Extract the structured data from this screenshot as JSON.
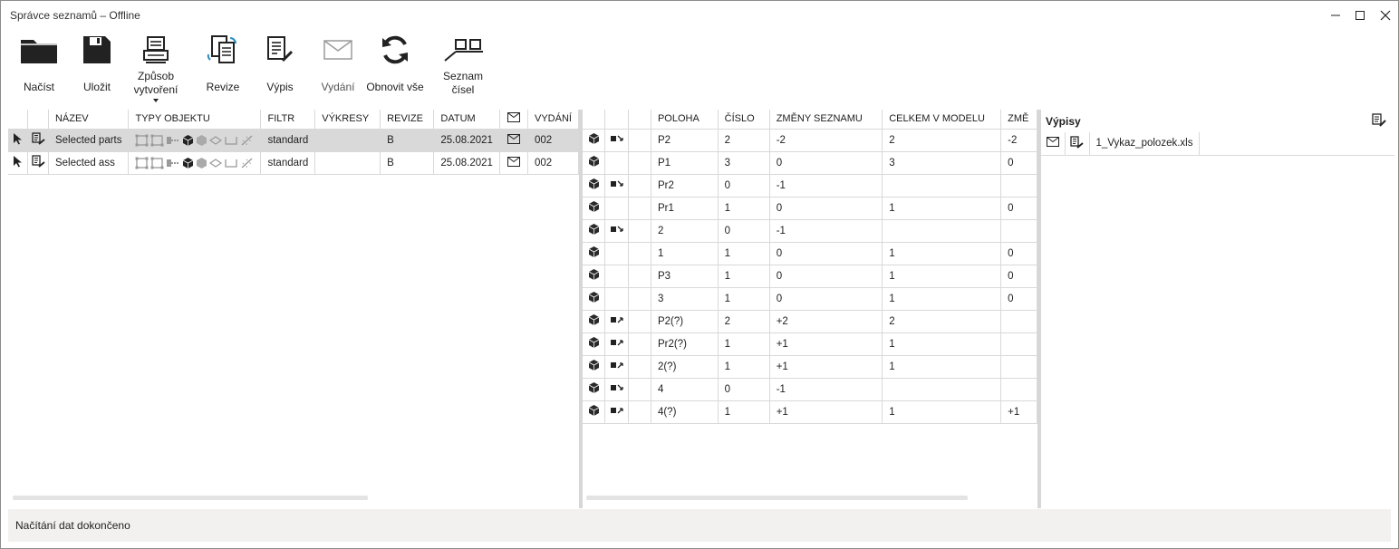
{
  "window": {
    "title": "Správce seznamů – Offline",
    "minimize_icon": "minimize-icon",
    "maximize_icon": "maximize-icon",
    "close_icon": "close-icon"
  },
  "toolbar": {
    "load_label": "Načíst",
    "save_label": "Uložit",
    "creation_label": "Způsob vytvoření",
    "revision_label": "Revize",
    "extract_label": "Výpis",
    "issue_label": "Vydání",
    "refresh_label": "Obnovit vše",
    "numbers_label": "Seznam čísel"
  },
  "lists": {
    "columns": [
      "",
      "",
      "NÁZEV",
      "TYPY OBJEKTU",
      "FILTR",
      "VÝKRESY",
      "REVIZE",
      "DATUM",
      "",
      "VYDÁNÍ"
    ],
    "rows": [
      {
        "name": "Selected parts",
        "filter": "standard",
        "drawings": "",
        "revision": "B",
        "date": "25.08.2021",
        "issue": "002",
        "selected": true
      },
      {
        "name": "Selected ass",
        "filter": "standard",
        "drawings": "",
        "revision": "B",
        "date": "25.08.2021",
        "issue": "002",
        "selected": false
      }
    ]
  },
  "changes": {
    "columns": [
      "",
      "",
      "",
      "POLOHA",
      "ČÍSLO",
      "ZMĚNY SEZNAMU",
      "CELKEM V MODELU",
      "ZMĚ"
    ],
    "rows": [
      {
        "change": "removed",
        "position": "P2",
        "number": "2",
        "list_changes": "-2",
        "total": "2",
        "delta": "-2"
      },
      {
        "change": "",
        "position": "P1",
        "number": "3",
        "list_changes": "0",
        "total": "3",
        "delta": "0"
      },
      {
        "change": "removed",
        "position": "Pr2",
        "number": "0",
        "list_changes": "-1",
        "total": "",
        "delta": ""
      },
      {
        "change": "",
        "position": "Pr1",
        "number": "1",
        "list_changes": "0",
        "total": "1",
        "delta": "0"
      },
      {
        "change": "removed",
        "position": "2",
        "number": "0",
        "list_changes": "-1",
        "total": "",
        "delta": ""
      },
      {
        "change": "",
        "position": "1",
        "number": "1",
        "list_changes": "0",
        "total": "1",
        "delta": "0"
      },
      {
        "change": "",
        "position": "P3",
        "number": "1",
        "list_changes": "0",
        "total": "1",
        "delta": "0"
      },
      {
        "change": "",
        "position": "3",
        "number": "1",
        "list_changes": "0",
        "total": "1",
        "delta": "0"
      },
      {
        "change": "added",
        "position": "P2(?)",
        "number": "2",
        "list_changes": "+2",
        "total": "2",
        "delta": ""
      },
      {
        "change": "added",
        "position": "Pr2(?)",
        "number": "1",
        "list_changes": "+1",
        "total": "1",
        "delta": ""
      },
      {
        "change": "added",
        "position": "2(?)",
        "number": "1",
        "list_changes": "+1",
        "total": "1",
        "delta": ""
      },
      {
        "change": "removed",
        "position": "4",
        "number": "0",
        "list_changes": "-1",
        "total": "",
        "delta": ""
      },
      {
        "change": "added",
        "position": "4(?)",
        "number": "1",
        "list_changes": "+1",
        "total": "1",
        "delta": "+1"
      }
    ]
  },
  "reports": {
    "title": "Výpisy",
    "files": [
      {
        "name": "1_Vykaz_polozek.xls"
      }
    ]
  },
  "status": {
    "text": "Načítání dat dokončeno"
  }
}
